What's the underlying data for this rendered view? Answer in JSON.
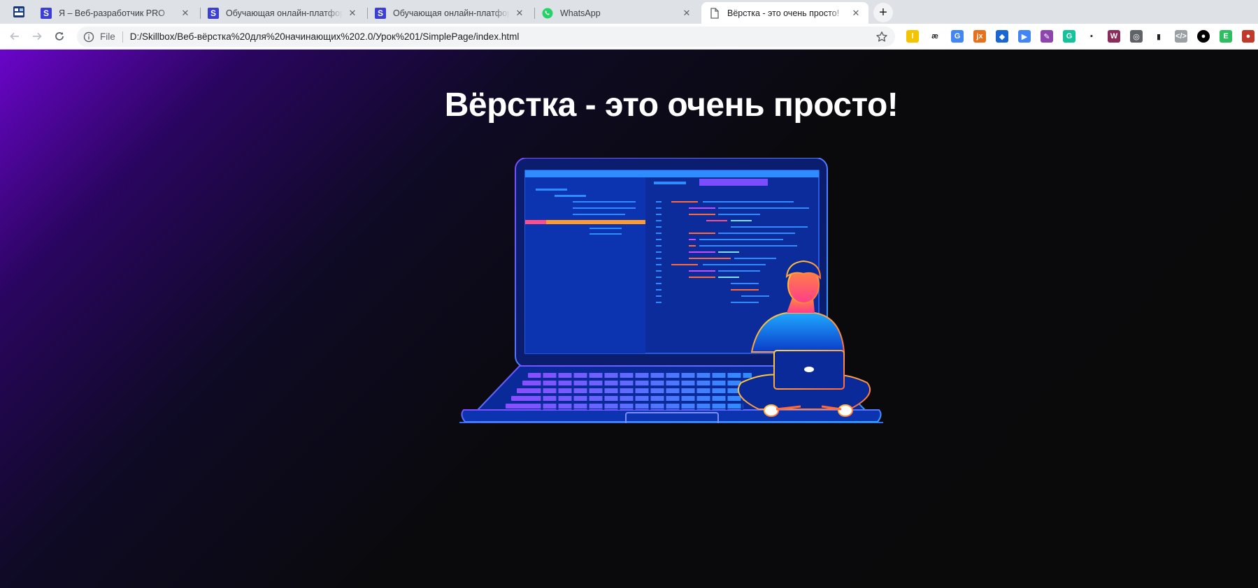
{
  "tabs": [
    {
      "title": "Я – Веб-разработчик PRO",
      "favicon": "S"
    },
    {
      "title": "Обучающая онлайн-платформа",
      "favicon": "S"
    },
    {
      "title": "Обучающая онлайн-платформа",
      "favicon": "S"
    },
    {
      "title": "WhatsApp",
      "favicon": "whatsapp-icon"
    },
    {
      "title": "Вёрстка - это очень просто!",
      "favicon": "document-icon"
    }
  ],
  "close_glyph": "✕",
  "new_tab_glyph": "+",
  "address_bar": {
    "scheme_label": "File",
    "url": "D:/Skillbox/Веб-вёрстка%20для%20начинающих%202.0/Урок%201/SimplePage/index.html"
  },
  "extensions": [
    {
      "name": "yellow-l-extension-icon",
      "glyph": "l",
      "color": "#f5c400"
    },
    {
      "name": "ae-extension-icon",
      "glyph": "æ",
      "color": "#ffffff"
    },
    {
      "name": "translate-extension-icon",
      "glyph": "G",
      "color": "#4285f4"
    },
    {
      "name": "jx-extension-icon",
      "glyph": "jx",
      "color": "#e8701a"
    },
    {
      "name": "diamond-extension-icon",
      "glyph": "◆",
      "color": "#1967d2"
    },
    {
      "name": "send-extension-icon",
      "glyph": "▶",
      "color": "#4285f4"
    },
    {
      "name": "feather-extension-icon",
      "glyph": "✎",
      "color": "#8e44ad"
    },
    {
      "name": "grammarly-extension-icon",
      "glyph": "G",
      "color": "#15c39a"
    },
    {
      "name": "grey-extension-icon",
      "glyph": "▪",
      "color": "#bdc1c6"
    },
    {
      "name": "w-extension-icon",
      "glyph": "W",
      "color": "#8b2c5a"
    },
    {
      "name": "bulb-extension-icon",
      "glyph": "◎",
      "color": "#5f6368"
    },
    {
      "name": "page-extension-icon",
      "glyph": "▮",
      "color": "#9ec5e8"
    },
    {
      "name": "code-extension-icon",
      "glyph": "</>",
      "color": "#9aa0a6"
    },
    {
      "name": "circle-extension-icon",
      "glyph": "●",
      "color": "#000000"
    },
    {
      "name": "evernote-extension-icon",
      "glyph": "E",
      "color": "#2dbe60"
    },
    {
      "name": "ladybug-extension-icon",
      "glyph": "●",
      "color": "#c0392b"
    }
  ],
  "page": {
    "title": "Вёрстка - это очень просто!",
    "hero_image": "developer-laptop-illustration",
    "colors": {
      "gradient_start": "#6a05c9",
      "gradient_end": "#0a0a0a",
      "title": "#ffffff"
    }
  }
}
